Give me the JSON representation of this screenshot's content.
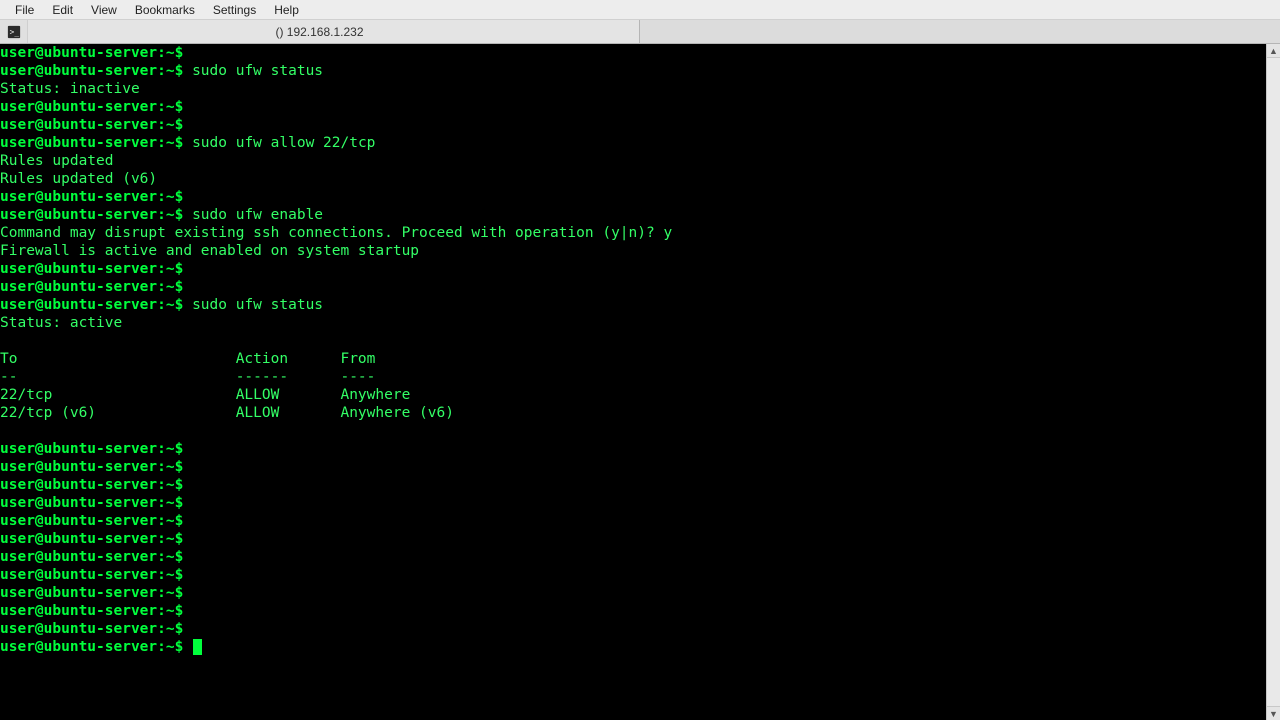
{
  "menubar": {
    "items": [
      "File",
      "Edit",
      "View",
      "Bookmarks",
      "Settings",
      "Help"
    ]
  },
  "tab": {
    "title": "() 192.168.1.232"
  },
  "session": {
    "user": "user",
    "host": "ubuntu-server",
    "path": "~",
    "symbol": "$"
  },
  "lines": [
    {
      "t": "prompt",
      "cmd": ""
    },
    {
      "t": "prompt",
      "cmd": "sudo ufw status"
    },
    {
      "t": "out",
      "text": "Status: inactive"
    },
    {
      "t": "prompt",
      "cmd": ""
    },
    {
      "t": "prompt",
      "cmd": ""
    },
    {
      "t": "prompt",
      "cmd": "sudo ufw allow 22/tcp"
    },
    {
      "t": "out",
      "text": "Rules updated"
    },
    {
      "t": "out",
      "text": "Rules updated (v6)"
    },
    {
      "t": "prompt",
      "cmd": ""
    },
    {
      "t": "prompt",
      "cmd": "sudo ufw enable"
    },
    {
      "t": "out",
      "text": "Command may disrupt existing ssh connections. Proceed with operation (y|n)? y"
    },
    {
      "t": "out",
      "text": "Firewall is active and enabled on system startup"
    },
    {
      "t": "prompt",
      "cmd": ""
    },
    {
      "t": "prompt",
      "cmd": ""
    },
    {
      "t": "prompt",
      "cmd": "sudo ufw status"
    },
    {
      "t": "out",
      "text": "Status: active"
    },
    {
      "t": "out",
      "text": ""
    },
    {
      "t": "out",
      "text": "To                         Action      From"
    },
    {
      "t": "out",
      "text": "--                         ------      ----"
    },
    {
      "t": "out",
      "text": "22/tcp                     ALLOW       Anywhere"
    },
    {
      "t": "out",
      "text": "22/tcp (v6)                ALLOW       Anywhere (v6)"
    },
    {
      "t": "out",
      "text": ""
    },
    {
      "t": "prompt",
      "cmd": ""
    },
    {
      "t": "prompt",
      "cmd": ""
    },
    {
      "t": "prompt",
      "cmd": ""
    },
    {
      "t": "prompt",
      "cmd": ""
    },
    {
      "t": "prompt",
      "cmd": ""
    },
    {
      "t": "prompt",
      "cmd": ""
    },
    {
      "t": "prompt",
      "cmd": ""
    },
    {
      "t": "prompt",
      "cmd": ""
    },
    {
      "t": "prompt",
      "cmd": ""
    },
    {
      "t": "prompt",
      "cmd": ""
    },
    {
      "t": "prompt",
      "cmd": ""
    },
    {
      "t": "prompt",
      "cmd": "",
      "cursor": true
    }
  ]
}
